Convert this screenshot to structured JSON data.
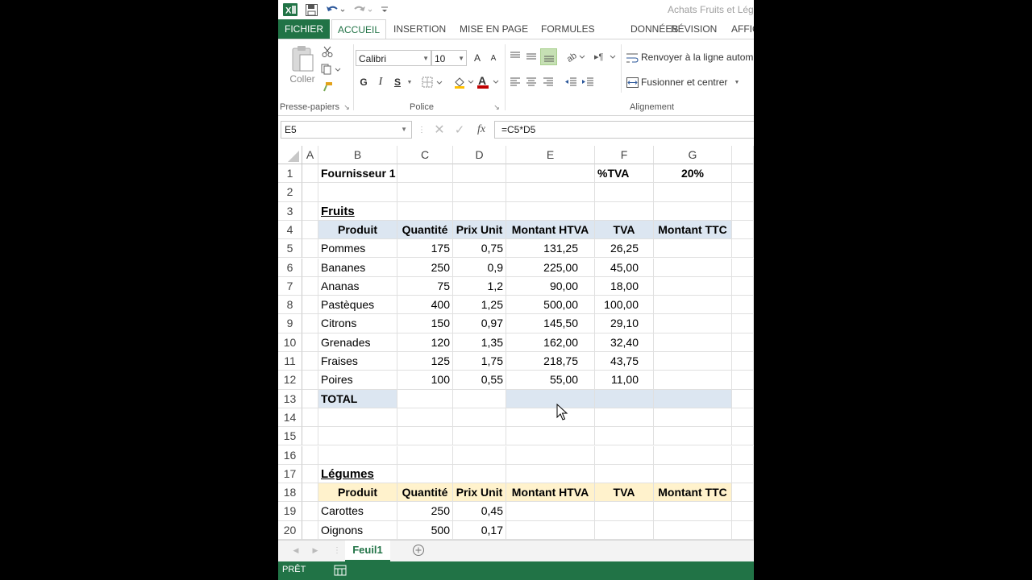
{
  "window": {
    "title": "Achats Fruits et Lég"
  },
  "ribbon_tabs": [
    "FICHIER",
    "ACCUEIL",
    "INSERTION",
    "MISE EN PAGE",
    "FORMULES",
    "DONNÉES",
    "RÉVISION",
    "AFFIC"
  ],
  "clipboard": {
    "paste_label": "Coller",
    "group_label": "Presse-papiers"
  },
  "font": {
    "name": "Calibri",
    "size": "10",
    "grow": "A",
    "shrink": "A",
    "bold": "G",
    "italic": "I",
    "underline": "S",
    "group_label": "Police"
  },
  "alignment": {
    "wrap_label": "Renvoyer à la ligne autom",
    "merge_label": "Fusionner et centrer",
    "group_label": "Alignement"
  },
  "formula_bar": {
    "name_box": "E5",
    "fx": "fx",
    "formula": "=C5*D5"
  },
  "columns": [
    "A",
    "B",
    "C",
    "D",
    "E",
    "F",
    "G"
  ],
  "rows": [
    "1",
    "2",
    "3",
    "4",
    "5",
    "6",
    "7",
    "8",
    "9",
    "10",
    "11",
    "12",
    "13",
    "14",
    "15",
    "16",
    "17",
    "18",
    "19",
    "20"
  ],
  "sheet": {
    "supplier": "Fournisseur 1",
    "vat_label": "%TVA",
    "vat_value": "20%",
    "fruits_title": "Fruits",
    "headers": [
      "Produit",
      "Quantité",
      "Prix Unit",
      "Montant HTVA",
      "TVA",
      "Montant TTC"
    ],
    "fruits": [
      {
        "produit": "Pommes",
        "quantite": "175",
        "prix": "0,75",
        "htva": "131,25",
        "tva": "26,25"
      },
      {
        "produit": "Bananes",
        "quantite": "250",
        "prix": "0,9",
        "htva": "225,00",
        "tva": "45,00"
      },
      {
        "produit": "Ananas",
        "quantite": "75",
        "prix": "1,2",
        "htva": "90,00",
        "tva": "18,00"
      },
      {
        "produit": "Pastèques",
        "quantite": "400",
        "prix": "1,25",
        "htva": "500,00",
        "tva": "100,00"
      },
      {
        "produit": "Citrons",
        "quantite": "150",
        "prix": "0,97",
        "htva": "145,50",
        "tva": "29,10"
      },
      {
        "produit": "Grenades",
        "quantite": "120",
        "prix": "1,35",
        "htva": "162,00",
        "tva": "32,40"
      },
      {
        "produit": "Fraises",
        "quantite": "125",
        "prix": "1,75",
        "htva": "218,75",
        "tva": "43,75"
      },
      {
        "produit": "Poires",
        "quantite": "100",
        "prix": "0,55",
        "htva": "55,00",
        "tva": "11,00"
      }
    ],
    "total_label": "TOTAL",
    "legumes_title": "Légumes",
    "legumes": [
      {
        "produit": "Carottes",
        "quantite": "250",
        "prix": "0,45"
      },
      {
        "produit": "Oignons",
        "quantite": "500",
        "prix": "0,17"
      }
    ]
  },
  "sheet_tab": "Feuil1",
  "status": "PRÊT",
  "colors": {
    "excel_green": "#217346",
    "header_blue": "#dce6f1",
    "header_yellow": "#fff2cc",
    "font_color_red": "#c00000"
  }
}
